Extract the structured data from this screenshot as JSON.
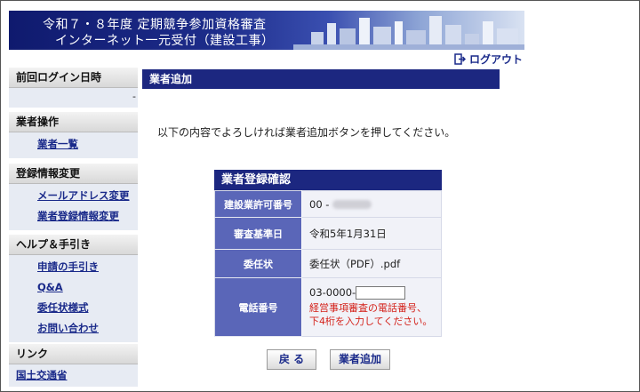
{
  "header": {
    "title_line1": "令和７・８年度 定期競争参加資格審査",
    "title_line2": "インターネット一元受付（建設工事）"
  },
  "logout_label": "ログアウト",
  "sidebar": {
    "last_login": {
      "heading": "前回ログイン日時",
      "value": "-"
    },
    "operations": {
      "heading": "業者操作",
      "items": [
        "業者一覧"
      ]
    },
    "registration": {
      "heading": "登録情報変更",
      "items": [
        "メールアドレス変更",
        "業者登録情報変更"
      ]
    },
    "help": {
      "heading": "ヘルプ＆手引き",
      "items": [
        "申請の手引き",
        "Q&A",
        "委任状様式",
        "お問い合わせ"
      ]
    },
    "links": {
      "heading": "リンク",
      "items": [
        "国土交通省"
      ]
    }
  },
  "main": {
    "title": "業者追加",
    "instruction": "以下の内容でよろしければ業者追加ボタンを押してください。",
    "confirm": {
      "caption": "業者登録確認",
      "rows": [
        {
          "label": "建設業許可番号",
          "value_prefix": "00 - "
        },
        {
          "label": "審査基準日",
          "value": "令和5年1月31日"
        },
        {
          "label": "委任状",
          "value": "委任状（PDF）.pdf"
        },
        {
          "label": "電話番号",
          "value_prefix": "03-0000-",
          "input_value": "",
          "note_line1": "経営事項審査の電話番号、",
          "note_line2": "下4桁を入力してください。"
        }
      ]
    },
    "buttons": {
      "back": "戻 る",
      "add": "業者追加"
    }
  },
  "colors": {
    "navy": "#1c2780",
    "row_header": "#5a66b8",
    "warning_red": "#d4211a"
  }
}
